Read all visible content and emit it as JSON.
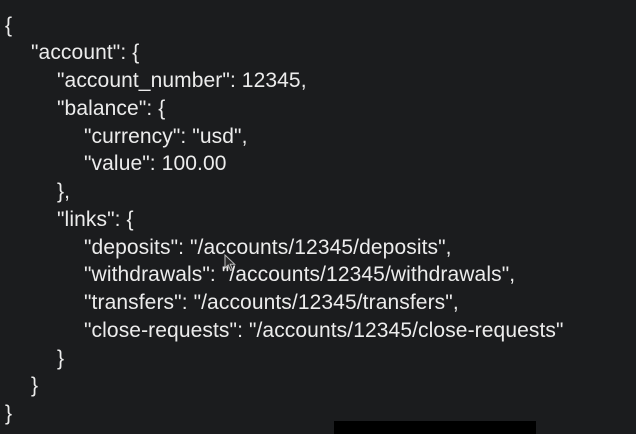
{
  "code_view": {
    "lines": [
      "{",
      "\"account\": {",
      "\"account_number\": 12345,",
      "\"balance\": {",
      "\"currency\": \"usd\",",
      "\"value\": 100.00",
      "},",
      "\"links\": {",
      "\"deposits\": \"/accounts/12345/deposits\",",
      "\"withdrawals\": \"/accounts/12345/withdrawals\",",
      "\"transfers\": \"/accounts/12345/transfers\",",
      "\"close-requests\": \"/accounts/12345/close-requests\"",
      "}",
      "}",
      "}"
    ]
  },
  "cursor": {
    "icon": "arrow-pointer-icon"
  },
  "colors": {
    "background": "#1b1c1e",
    "text": "#ececec",
    "caption_background": "#000000"
  }
}
